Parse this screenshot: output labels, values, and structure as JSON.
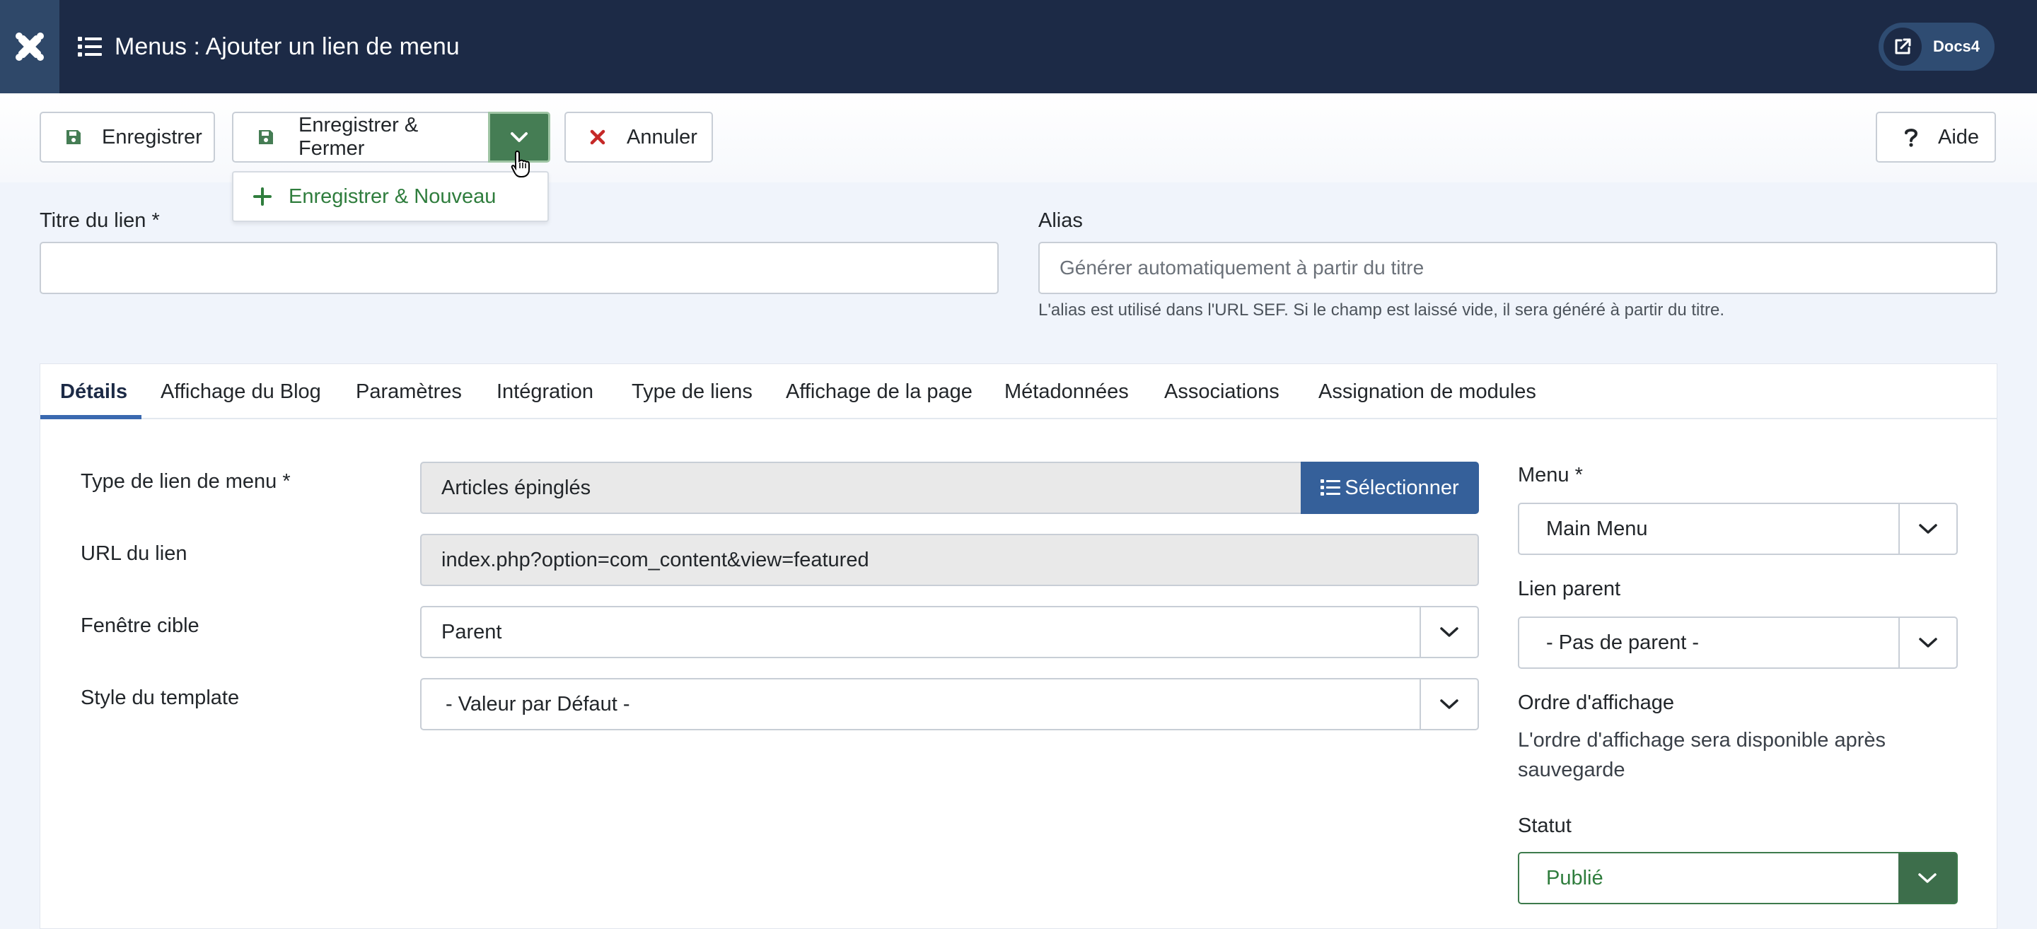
{
  "header": {
    "title": "Menus : Ajouter un lien de menu",
    "docs_label": "Docs4"
  },
  "toolbar": {
    "save_label": "Enregistrer",
    "save_close_label": "Enregistrer & Fermer",
    "cancel_label": "Annuler",
    "help_label": "Aide",
    "dropdown_item_label": "Enregistrer & Nouveau"
  },
  "form": {
    "title_label": "Titre du lien *",
    "title_value": "",
    "alias_label": "Alias",
    "alias_placeholder": "Générer automatiquement à partir du titre",
    "alias_hint": "L'alias est utilisé dans l'URL SEF. Si le champ est laissé vide, il sera généré à partir du titre."
  },
  "tabs": [
    {
      "label": "Détails"
    },
    {
      "label": "Affichage du Blog"
    },
    {
      "label": "Paramètres"
    },
    {
      "label": "Intégration"
    },
    {
      "label": "Type de liens"
    },
    {
      "label": "Affichage de la page"
    },
    {
      "label": "Métadonnées"
    },
    {
      "label": "Associations"
    },
    {
      "label": "Assignation de modules"
    }
  ],
  "details": {
    "menu_type_label": "Type de lien de menu *",
    "menu_type_value": "Articles épinglés",
    "select_button_label": "Sélectionner",
    "url_label": "URL du lien",
    "url_value": "index.php?option=com_content&view=featured",
    "target_label": "Fenêtre cible",
    "target_value": "Parent",
    "template_label": "Style du template",
    "template_value": "- Valeur par Défaut -"
  },
  "side": {
    "menu_label": "Menu *",
    "menu_value": "Main Menu",
    "parent_label": "Lien parent",
    "parent_value": "- Pas de parent -",
    "order_label": "Ordre d'affichage",
    "order_text_1": "L'ordre d'affichage sera disponible après",
    "order_text_2": "sauvegarde",
    "status_label": "Statut",
    "status_value": "Publié"
  },
  "colors": {
    "header_bg": "#1c2a46",
    "success_green": "#457d54",
    "primary_blue": "#35609a",
    "danger_red": "#c52827"
  },
  "icons": {
    "logo": "joomla-logo-icon",
    "title": "list-icon",
    "docs": "external-link-icon",
    "save": "floppy-disk-icon",
    "caret": "chevron-down-icon",
    "cancel": "close-icon",
    "help": "question-icon",
    "new": "plus-icon"
  }
}
